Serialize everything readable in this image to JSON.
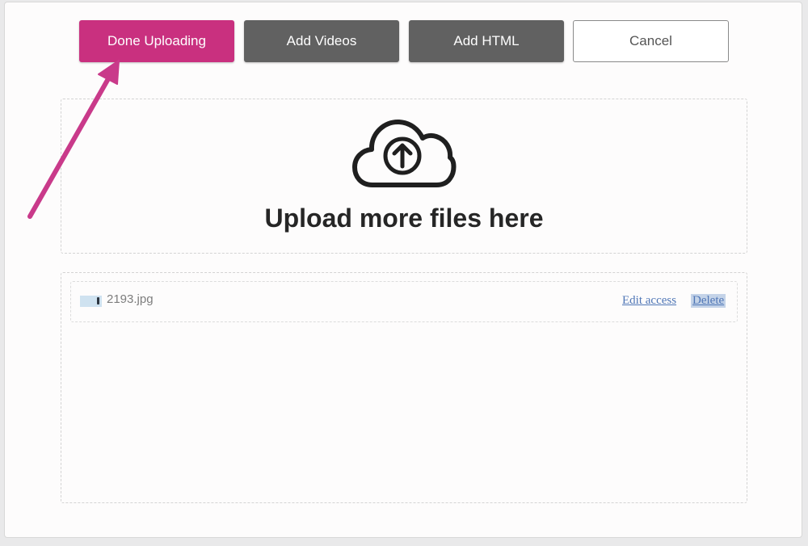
{
  "toolbar": {
    "done_label": "Done Uploading",
    "videos_label": "Add Videos",
    "html_label": "Add HTML",
    "cancel_label": "Cancel"
  },
  "dropzone": {
    "icon": "cloud-upload-icon",
    "text": "Upload more files here"
  },
  "files": [
    {
      "name": "2193.jpg",
      "edit_label": "Edit access",
      "delete_label": "Delete"
    }
  ],
  "colors": {
    "primary": "#c9307f",
    "secondary_button": "#616161",
    "link": "#4f76b6",
    "annotation_arrow": "#c93a8a"
  }
}
